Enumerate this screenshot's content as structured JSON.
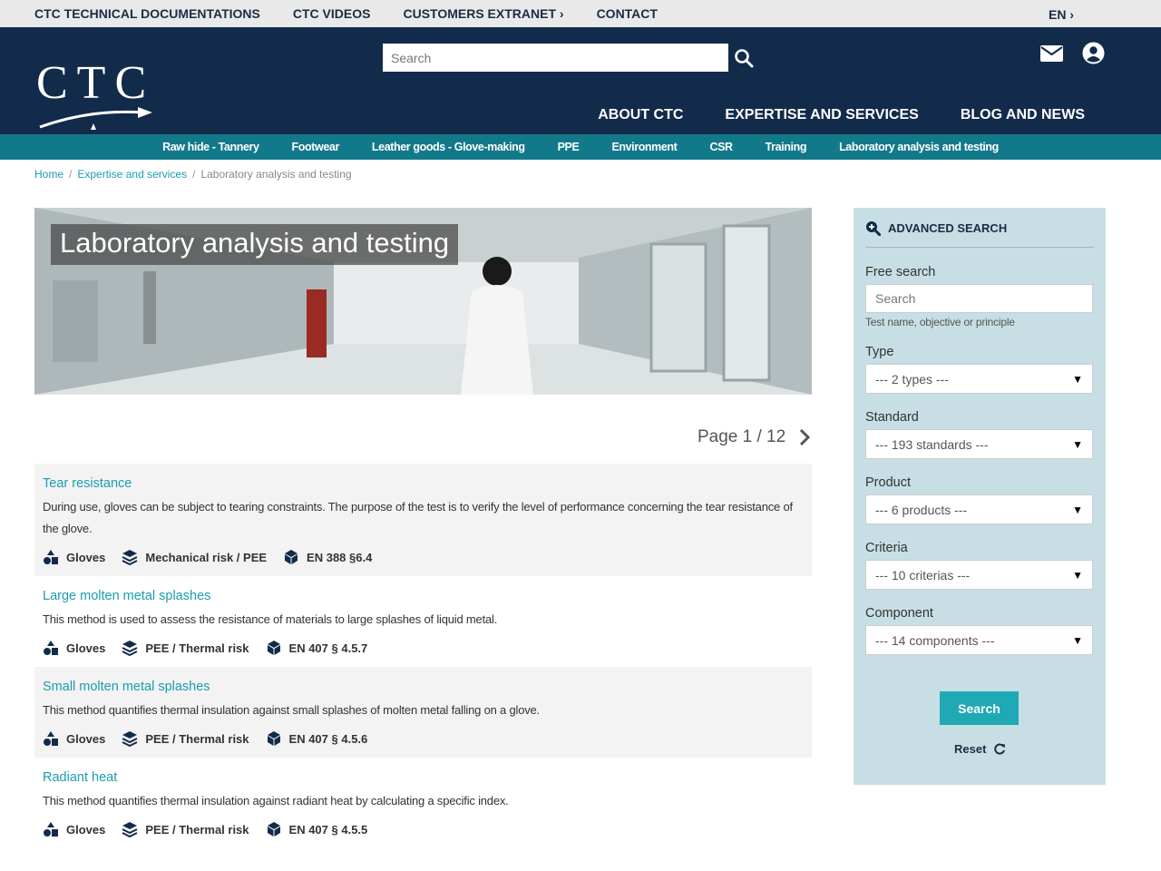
{
  "topbar": {
    "links": [
      "CTC TECHNICAL DOCUMENTATIONS",
      "CTC VIDEOS",
      "CUSTOMERS EXTRANET ›",
      "CONTACT"
    ],
    "lang": "EN ›"
  },
  "header": {
    "logo_text": "CTC",
    "search_placeholder": "Search",
    "main_nav": [
      "ABOUT CTC",
      "EXPERTISE AND SERVICES",
      "BLOG AND NEWS"
    ]
  },
  "subnav": [
    "Raw hide - Tannery",
    "Footwear",
    "Leather goods - Glove-making",
    "PPE",
    "Environment",
    "CSR",
    "Training",
    "Laboratory analysis and testing"
  ],
  "breadcrumb": [
    "Home",
    "Expertise and services",
    "Laboratory analysis and testing"
  ],
  "hero": {
    "title": "Laboratory analysis and testing"
  },
  "pager": {
    "label": "Page 1 / 12"
  },
  "results": [
    {
      "title": "Tear resistance",
      "desc": "During use, gloves can be subject to tearing constraints. The purpose of the test is to verify the level of performance concerning the tear resistance of the glove.",
      "product": "Gloves",
      "type": "Mechanical risk / PEE",
      "standard": "EN 388 §6.4"
    },
    {
      "title": "Large molten metal splashes",
      "desc": "This method is used to assess the resistance of materials to large splashes of liquid metal.",
      "product": "Gloves",
      "type": "PEE / Thermal risk",
      "standard": "EN 407 § 4.5.7"
    },
    {
      "title": "Small molten metal splashes",
      "desc": "This method quantifies thermal insulation against small splashes of molten metal falling on a glove.",
      "product": "Gloves",
      "type": "PEE / Thermal risk",
      "standard": "EN 407 § 4.5.6"
    },
    {
      "title": "Radiant heat",
      "desc": "This method quantifies thermal insulation against radiant heat by calculating a specific index.",
      "product": "Gloves",
      "type": "PEE / Thermal risk",
      "standard": "EN 407 § 4.5.5"
    }
  ],
  "sidebar": {
    "heading": "ADVANCED SEARCH",
    "free_label": "Free search",
    "free_placeholder": "Search",
    "free_hint": "Test name, objective or principle",
    "type_label": "Type",
    "type_value": "--- 2 types ---",
    "standard_label": "Standard",
    "standard_value": "--- 193 standards ---",
    "product_label": "Product",
    "product_value": "--- 6 products ---",
    "criteria_label": "Criteria",
    "criteria_value": "--- 10 criterias ---",
    "component_label": "Component",
    "component_value": "--- 14 components ---",
    "search_label": "Search",
    "reset_label": "Reset"
  },
  "colors": {
    "navy": "#122b4a",
    "teal": "#12798a",
    "accent": "#1a9db0",
    "sidebar_bg": "#c7dfe4"
  }
}
